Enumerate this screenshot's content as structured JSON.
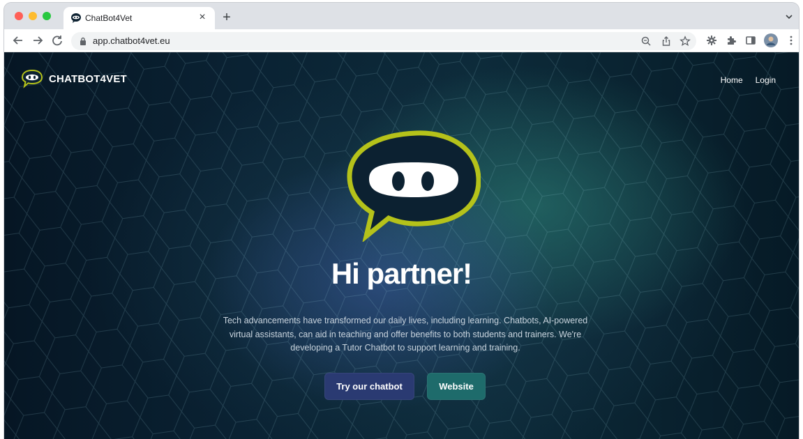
{
  "browser": {
    "tab_title": "ChatBot4Vet",
    "tab_close": "×",
    "new_tab": "+",
    "url": "app.chatbot4vet.eu",
    "icons": [
      "back-icon",
      "forward-icon",
      "reload-icon",
      "lock-icon",
      "zoom-icon",
      "share-icon",
      "star-icon",
      "extension-gear-icon",
      "extensions-puzzle-icon",
      "sidepanel-icon",
      "profile-avatar",
      "kebab-menu-icon"
    ],
    "colors": {
      "close": "#ff5f57",
      "minimize": "#febc2e",
      "maximize": "#28c840"
    }
  },
  "site": {
    "brand": "CHATBOT4VET",
    "nav": {
      "home": "Home",
      "login": "Login"
    },
    "hero": {
      "title": "Hi partner!",
      "text": "Tech advancements have transformed our daily lives, including learning. Chatbots, AI-powered virtual assistants, can aid in teaching and offer benefits to both students and trainers. We're developing a Tutor Chatbot to support learning and training.",
      "primary_button": "Try our chatbot",
      "secondary_button": "Website"
    },
    "colors": {
      "logo_outline": "#b5c21a",
      "logo_fill": "#0c2131",
      "primary_button": "#2a3a72",
      "secondary_button": "#1e6b6b"
    }
  }
}
